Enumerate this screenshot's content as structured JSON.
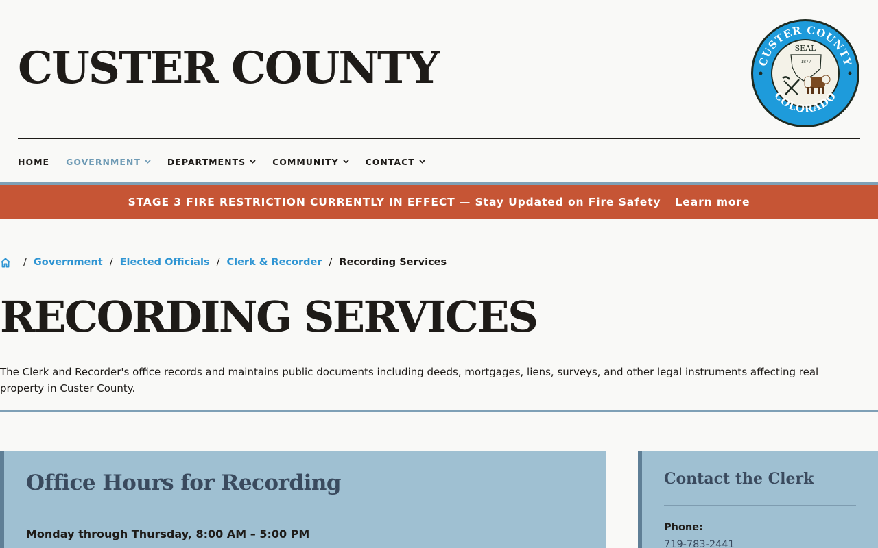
{
  "header": {
    "site_title": "CUSTER COUNTY",
    "seal": {
      "top_text": "CUSTER COUNTY",
      "bottom_text": "COLORADO",
      "center_label": "SEAL",
      "year": "1877"
    }
  },
  "nav": {
    "items": [
      {
        "label": "HOME",
        "has_dropdown": false,
        "active": false
      },
      {
        "label": "GOVERNMENT",
        "has_dropdown": true,
        "active": true
      },
      {
        "label": "DEPARTMENTS",
        "has_dropdown": true,
        "active": false
      },
      {
        "label": "COMMUNITY",
        "has_dropdown": true,
        "active": false
      },
      {
        "label": "CONTACT",
        "has_dropdown": true,
        "active": false
      }
    ]
  },
  "alert": {
    "message": "STAGE 3 FIRE RESTRICTION CURRENTLY IN EFFECT — Stay Updated on Fire Safety",
    "link_label": "Learn more"
  },
  "breadcrumb": {
    "items": [
      "Government",
      "Elected Officials",
      "Clerk & Recorder"
    ],
    "current": "Recording Services",
    "separator": "/"
  },
  "page": {
    "title": "RECORDING SERVICES",
    "intro": "The Clerk and Recorder's office records and maintains public documents including deeds, mortgages, liens, surveys, and other legal instruments affecting real property in Custer County."
  },
  "hours_card": {
    "title": "Office Hours for Recording",
    "line1": "Monday through Thursday, 8:00 AM – 5:00 PM"
  },
  "contact_card": {
    "title": "Contact the Clerk",
    "phone_label": "Phone:",
    "phone_value": "719-783-2441"
  },
  "colors": {
    "alert_bg": "#c65535",
    "link": "#2f95d3",
    "nav_active": "#6f9bb5",
    "card_bg": "#9fc0d2",
    "text": "#1e1b18",
    "seal_blue": "#1e9bdb"
  },
  "icons": {
    "home": "home-icon",
    "dropdown": "chevron-down-icon"
  }
}
